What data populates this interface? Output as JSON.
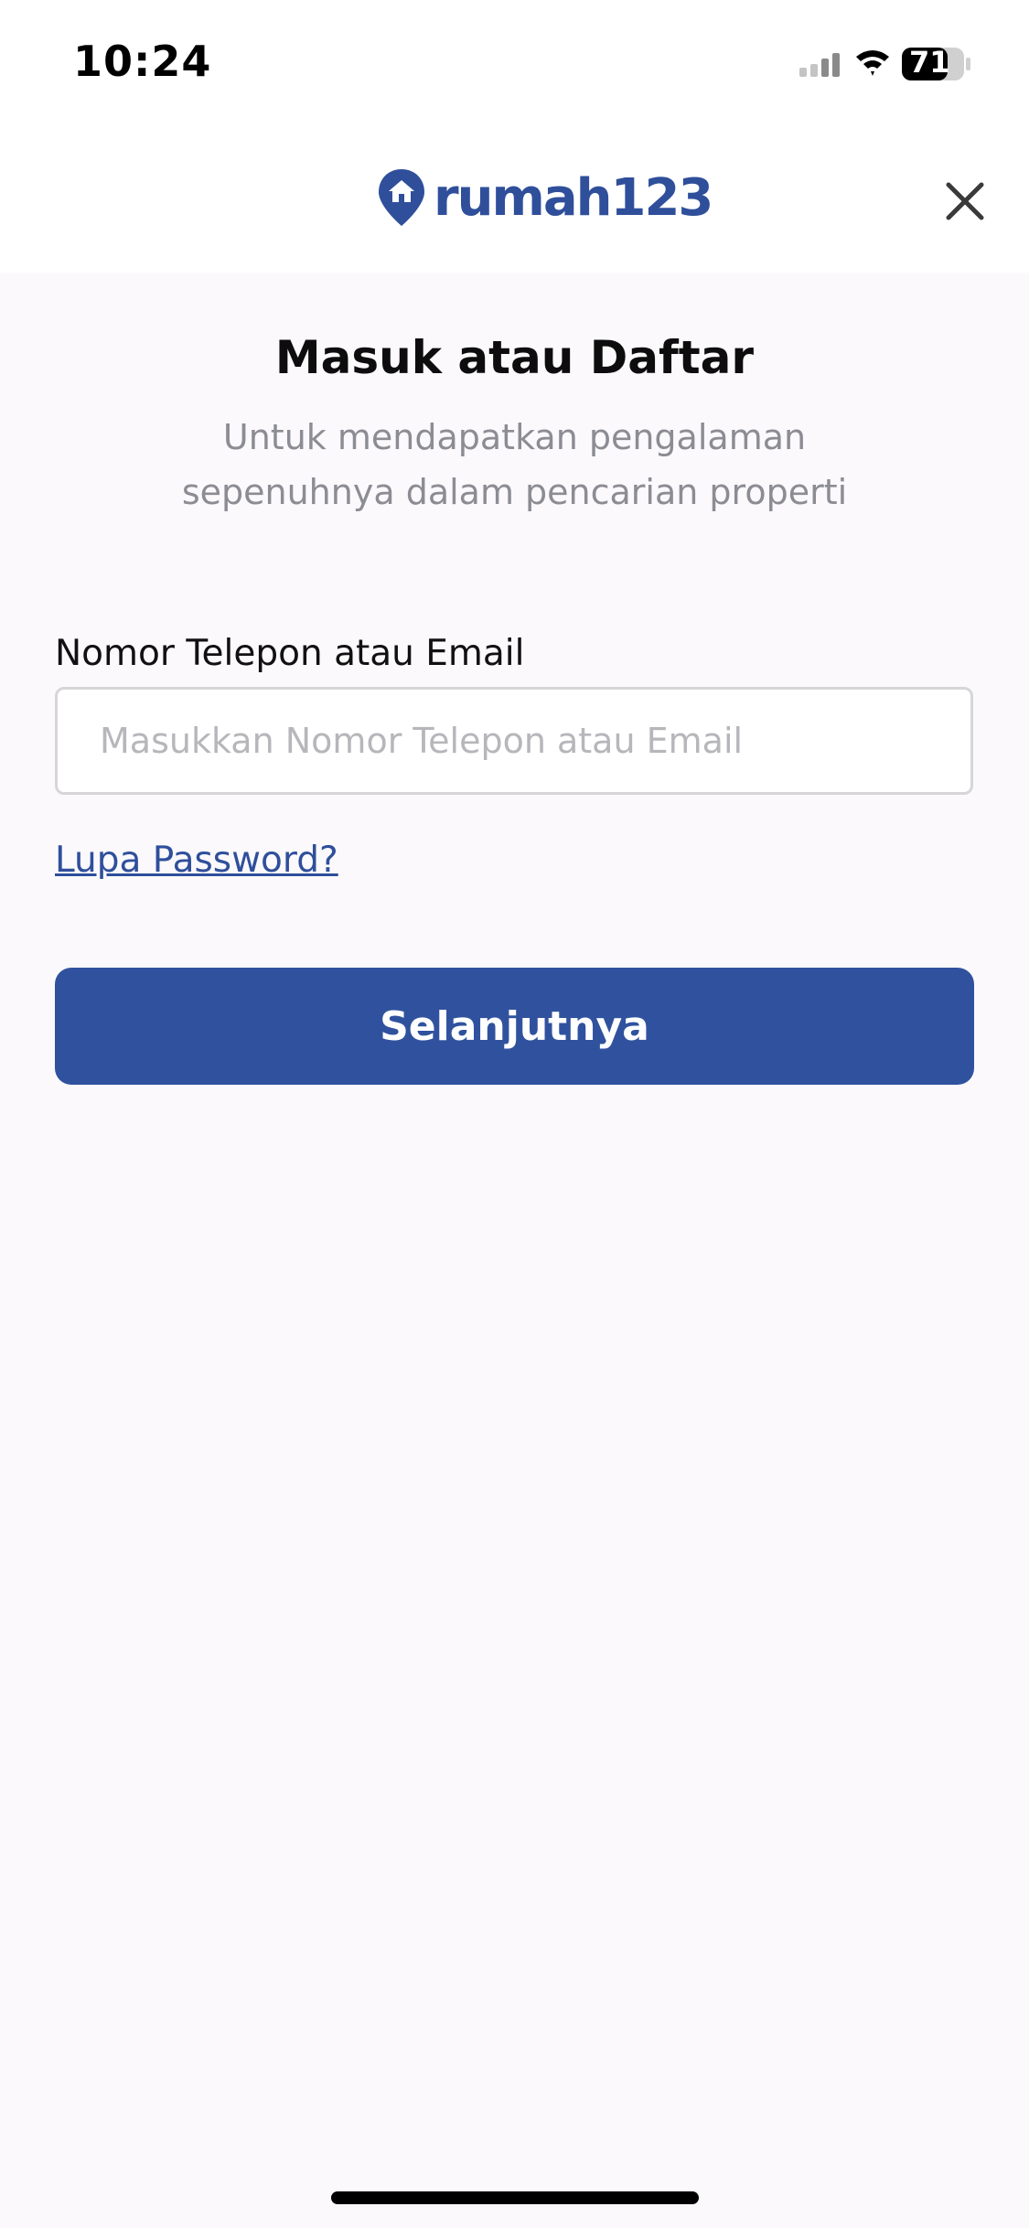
{
  "status_bar": {
    "time": "10:24",
    "battery": "71",
    "icons": [
      "signal-icon",
      "wifi-icon",
      "battery-icon"
    ]
  },
  "header": {
    "logo_text": "rumah123",
    "close_icon": "close-icon"
  },
  "main": {
    "title": "Masuk atau Daftar",
    "subtitle": "Untuk mendapatkan pengalaman sepenuhnya dalam pencarian properti",
    "field_label": "Nomor Telepon atau Email",
    "field_placeholder": "Masukkan Nomor Telepon atau Email",
    "field_value": "",
    "forgot_password": "Lupa Password?",
    "next_button": "Selanjutnya"
  },
  "colors": {
    "brand": "#30529e",
    "background": "#fbf9fc",
    "muted_text": "#8c8c93"
  }
}
